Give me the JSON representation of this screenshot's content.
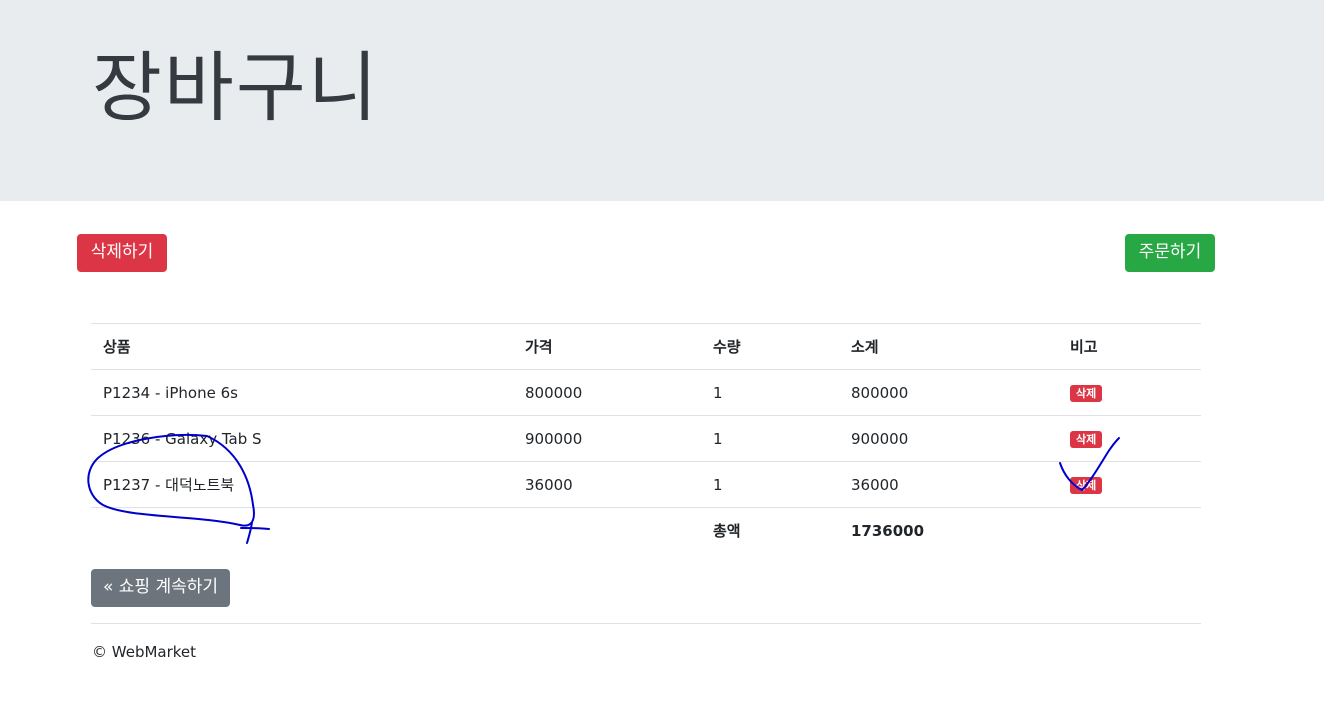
{
  "header": {
    "title": "장바구니"
  },
  "actions": {
    "delete_all_label": "삭제하기",
    "order_label": "주문하기"
  },
  "cart": {
    "columns": [
      "상품",
      "가격",
      "수량",
      "소계",
      "비고"
    ],
    "items": [
      {
        "product": "P1234 - iPhone 6s",
        "price": "800000",
        "qty": "1",
        "subtotal": "800000",
        "remove": "삭제"
      },
      {
        "product": "P1236 - Galaxy Tab S",
        "price": "900000",
        "qty": "1",
        "subtotal": "900000",
        "remove": "삭제"
      },
      {
        "product": "P1237 - 대덕노트북",
        "price": "36000",
        "qty": "1",
        "subtotal": "36000",
        "remove": "삭제"
      }
    ],
    "total_label": "총액",
    "total_value": "1736000"
  },
  "continue_label": "« 쇼핑 계속하기",
  "footer": {
    "copyright": "© WebMarket"
  },
  "colors": {
    "danger": "#dc3545",
    "success": "#28a745",
    "secondary": "#6c757d",
    "jumbotron": "#e9ecef",
    "ink": "#0000cc"
  }
}
